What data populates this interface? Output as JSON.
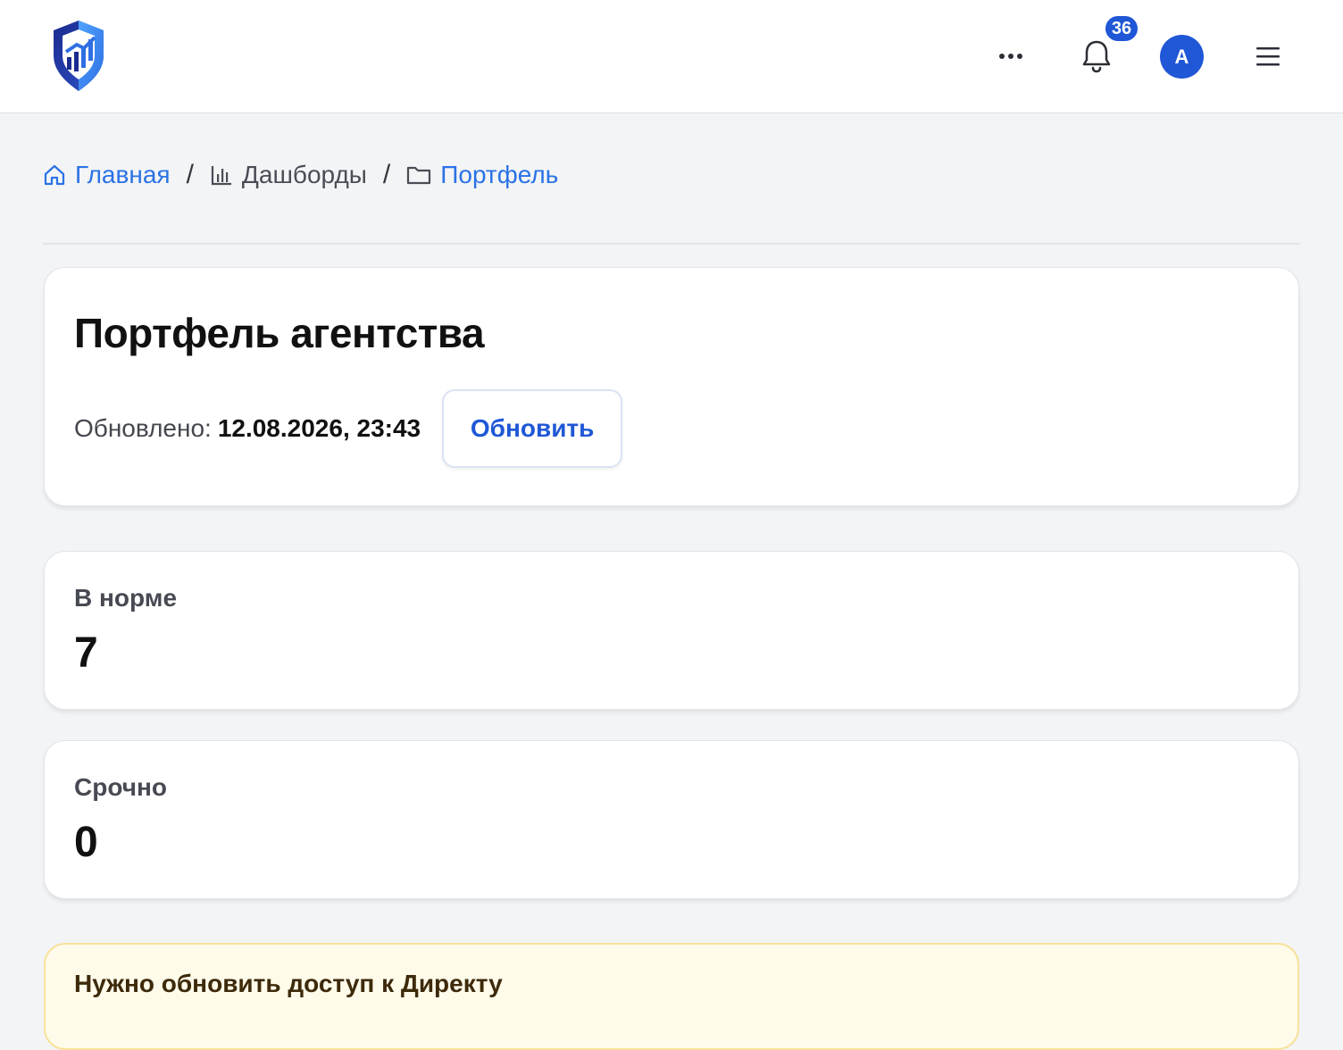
{
  "header": {
    "logo_icon": "shield-chart-logo",
    "more_icon": "more-horizontal-icon",
    "bell_icon": "bell-icon",
    "notification_count": "36",
    "avatar_initial": "A",
    "menu_icon": "hamburger-menu-icon",
    "colors": {
      "accent": "#1f57d6",
      "logo_dark": "#1b2a8f",
      "logo_light": "#3f8cf5"
    }
  },
  "breadcrumb": {
    "items": [
      {
        "label": "Главная",
        "icon": "home-icon"
      },
      {
        "label": "Дашборды",
        "icon": "bar-chart-icon"
      },
      {
        "label": "Портфель",
        "icon": "folder-icon"
      }
    ],
    "separator": "/"
  },
  "summary": {
    "title": "Портфель агентства",
    "updated_label": "Обновлено:",
    "updated_value": "12.08.2026, 23:43",
    "refresh_label": "Обновить"
  },
  "stats": [
    {
      "label": "В норме",
      "value": "7"
    },
    {
      "label": "Срочно",
      "value": "0"
    }
  ],
  "alert": {
    "title": "Нужно обновить доступ к Директу",
    "colors": {
      "background": "#fffbea",
      "border": "#f7e29a"
    }
  }
}
